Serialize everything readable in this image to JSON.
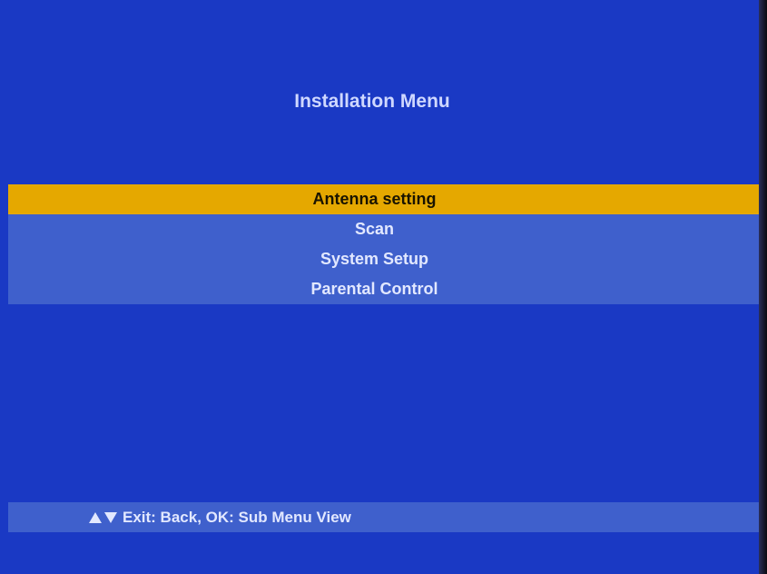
{
  "menu": {
    "title": "Installation Menu",
    "items": [
      {
        "label": "Antenna setting",
        "selected": true
      },
      {
        "label": "Scan",
        "selected": false
      },
      {
        "label": "System Setup",
        "selected": false
      },
      {
        "label": "Parental Control",
        "selected": false
      }
    ]
  },
  "status_bar": {
    "hint": "Exit: Back, OK: Sub Menu View",
    "nav_icons": [
      "arrow-up-icon",
      "arrow-down-icon"
    ]
  },
  "colors": {
    "background": "#1a39c4",
    "menu_band": "#3f60cc",
    "highlight": "#e5a800"
  }
}
